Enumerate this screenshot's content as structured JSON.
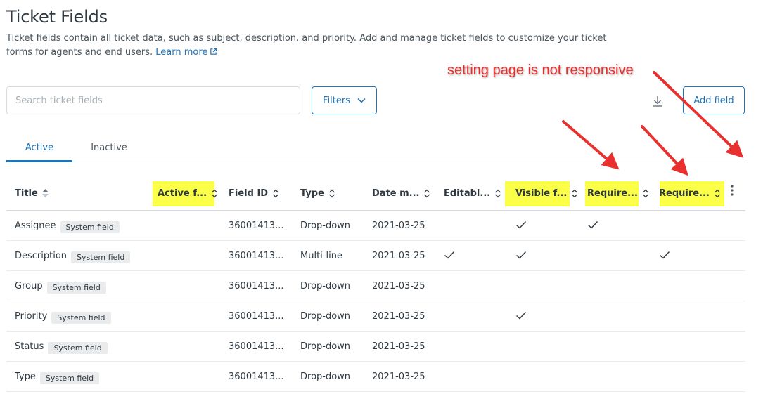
{
  "page": {
    "title": "Ticket Fields",
    "description": "Ticket fields contain all ticket data, such as subject, description, and priority. Add and manage ticket fields to customize your ticket forms for agents and end users.",
    "learn_more": "Learn more"
  },
  "toolbar": {
    "search_placeholder": "Search ticket fields",
    "filters_label": "Filters",
    "add_field_label": "Add field"
  },
  "tabs": [
    {
      "label": "Active",
      "active": true
    },
    {
      "label": "Inactive",
      "active": false
    }
  ],
  "table": {
    "columns": [
      {
        "label": "Title"
      },
      {
        "label": "Active f..."
      },
      {
        "label": "Field ID"
      },
      {
        "label": "Type"
      },
      {
        "label": "Date m..."
      },
      {
        "label": "Editabl..."
      },
      {
        "label": "Visible f..."
      },
      {
        "label": "Require..."
      },
      {
        "label": "Require..."
      }
    ],
    "rows": [
      {
        "title": "Assignee",
        "badge": "System field",
        "field_id": "36001413...",
        "type": "Drop-down",
        "date": "2021-03-25",
        "editable": false,
        "visible": true,
        "required1": true,
        "required2": false
      },
      {
        "title": "Description",
        "badge": "System field",
        "field_id": "36001413...",
        "type": "Multi-line",
        "date": "2021-03-25",
        "editable": true,
        "visible": true,
        "required1": false,
        "required2": true
      },
      {
        "title": "Group",
        "badge": "System field",
        "field_id": "36001413...",
        "type": "Drop-down",
        "date": "2021-03-25",
        "editable": false,
        "visible": false,
        "required1": false,
        "required2": false
      },
      {
        "title": "Priority",
        "badge": "System field",
        "field_id": "36001413...",
        "type": "Drop-down",
        "date": "2021-03-25",
        "editable": false,
        "visible": true,
        "required1": false,
        "required2": false
      },
      {
        "title": "Status",
        "badge": "System field",
        "field_id": "36001413...",
        "type": "Drop-down",
        "date": "2021-03-25",
        "editable": false,
        "visible": false,
        "required1": false,
        "required2": false
      },
      {
        "title": "Type",
        "badge": "System field",
        "field_id": "36001413...",
        "type": "Drop-down",
        "date": "2021-03-25",
        "editable": false,
        "visible": false,
        "required1": false,
        "required2": false
      }
    ]
  },
  "annotation": {
    "text": "setting page is not responsive",
    "color": "#e8312f",
    "highlight_color": "#fbff47"
  },
  "colors": {
    "accent": "#1f73b7",
    "text": "#2f3941",
    "border": "#d8dcde"
  }
}
